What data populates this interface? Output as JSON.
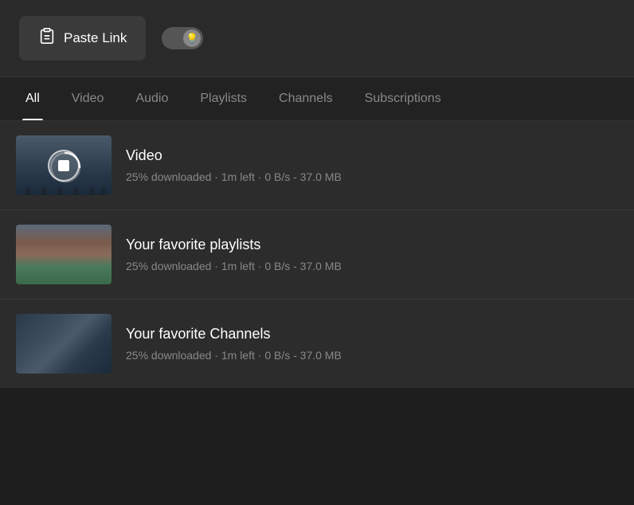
{
  "topbar": {
    "paste_link_label": "Paste Link",
    "paste_icon": "⊙"
  },
  "toggle": {
    "active": false
  },
  "tabs": [
    {
      "id": "all",
      "label": "All",
      "active": true
    },
    {
      "id": "video",
      "label": "Video",
      "active": false
    },
    {
      "id": "audio",
      "label": "Audio",
      "active": false
    },
    {
      "id": "playlists",
      "label": "Playlists",
      "active": false
    },
    {
      "id": "channels",
      "label": "Channels",
      "active": false
    },
    {
      "id": "subscriptions",
      "label": "Subscriptions",
      "active": false
    }
  ],
  "downloads": [
    {
      "id": "video-item",
      "title": "Video",
      "status": "25% downloaded · 1m left · 0 B/s - 37.0 MB",
      "thumbnail_type": "snow",
      "has_stop_button": true,
      "progress": 25
    },
    {
      "id": "playlists-item",
      "title": "Your favorite playlists",
      "status": "25% downloaded · 1m left · 0 B/s - 37.0 MB",
      "thumbnail_type": "canyon",
      "has_stop_button": false,
      "progress": 25
    },
    {
      "id": "channels-item",
      "title": "Your favorite Channels",
      "status": "25% downloaded · 1m left · 0 B/s - 37.0 MB",
      "thumbnail_type": "ice",
      "has_stop_button": false,
      "progress": 25
    }
  ],
  "colors": {
    "bg_main": "#1e1e1e",
    "bg_topbar": "#2a2a2a",
    "bg_list": "#2c2c2c",
    "accent_white": "#ffffff",
    "text_secondary": "#888888"
  }
}
